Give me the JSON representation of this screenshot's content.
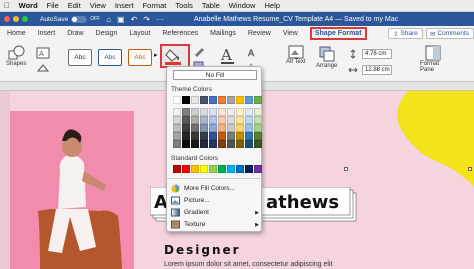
{
  "menubar": {
    "app": "Word",
    "items": [
      "File",
      "Edit",
      "View",
      "Insert",
      "Format",
      "Tools",
      "Table",
      "Window",
      "Help"
    ]
  },
  "titlebar": {
    "autosave_label": "AutoSave",
    "autosave_state": "OFF",
    "document_title": "Anabelle Mathews Resume_CV Template A4 — Saved to my Mac"
  },
  "tabs": [
    "Home",
    "Insert",
    "Draw",
    "Design",
    "Layout",
    "References",
    "Mailings",
    "Review",
    "View"
  ],
  "active_tab": "Shape Format",
  "share_label": "Share",
  "comments_label": "Comments",
  "ribbon": {
    "shapes_label": "Shapes",
    "style_previews": [
      "Abc",
      "Abc",
      "Abc"
    ],
    "alt_text_label": "Alt Text",
    "arrange_label": "Arrange",
    "format_pane_label": "Format Pane",
    "height_value": "4.76 cm",
    "width_value": "12.88 cm"
  },
  "fill_menu": {
    "no_fill": "No Fill",
    "theme_colors_label": "Theme Colors",
    "standard_colors_label": "Standard Colors",
    "theme_top_row": [
      "#ffffff",
      "#000000",
      "#e7e6e6",
      "#44546a",
      "#4472c4",
      "#ed7d31",
      "#a5a5a5",
      "#ffc000",
      "#5b9bd5",
      "#70ad47"
    ],
    "theme_shades": [
      [
        "#f2f2f2",
        "#7f7f7f",
        "#d0cece",
        "#d6dce4",
        "#d9e2f3",
        "#fbe5d5",
        "#ededed",
        "#fff2cc",
        "#deebf6",
        "#e2efd9"
      ],
      [
        "#d8d8d8",
        "#595959",
        "#aeabab",
        "#adb9ca",
        "#b4c6e7",
        "#f7cbac",
        "#dbdbdb",
        "#fee599",
        "#bdd7ee",
        "#c5e0b3"
      ],
      [
        "#bfbfbf",
        "#3f3f3f",
        "#757070",
        "#8496b0",
        "#8eaadb",
        "#f4b183",
        "#c9c9c9",
        "#ffd965",
        "#9cc3e5",
        "#a8d08d"
      ],
      [
        "#a5a5a5",
        "#262626",
        "#3a3838",
        "#323f4f",
        "#2f5496",
        "#c55a11",
        "#7b7b7b",
        "#bf9000",
        "#2e75b5",
        "#538135"
      ],
      [
        "#7f7f7f",
        "#0c0c0c",
        "#171616",
        "#222a35",
        "#1f3864",
        "#833c0b",
        "#525252",
        "#7f6000",
        "#1e4e79",
        "#375623"
      ]
    ],
    "standard_colors": [
      "#c00000",
      "#ff0000",
      "#ffc000",
      "#ffff00",
      "#92d050",
      "#00b050",
      "#00b0f0",
      "#0070c0",
      "#002060",
      "#7030a0"
    ],
    "items": [
      {
        "label": "More Fill Colors...",
        "icon": "color-wheel-icon",
        "submenu": false
      },
      {
        "label": "Picture...",
        "icon": "picture-icon",
        "submenu": false
      },
      {
        "label": "Gradient",
        "icon": "gradient-icon",
        "submenu": true
      },
      {
        "label": "Texture",
        "icon": "texture-icon",
        "submenu": true
      }
    ]
  },
  "document": {
    "name_visible_left": "A",
    "name_visible_right": "athews",
    "title": "Designer",
    "lorem": "Lorem ipsum dolor sit amet, consectetur adipiscing elit"
  },
  "colors": {
    "word_blue": "#2b579a",
    "highlight_red": "#d83b3b",
    "page_pink": "#f5d4dd",
    "photo_pink": "#f28cad",
    "shape_yellow": "#f2e31a"
  }
}
